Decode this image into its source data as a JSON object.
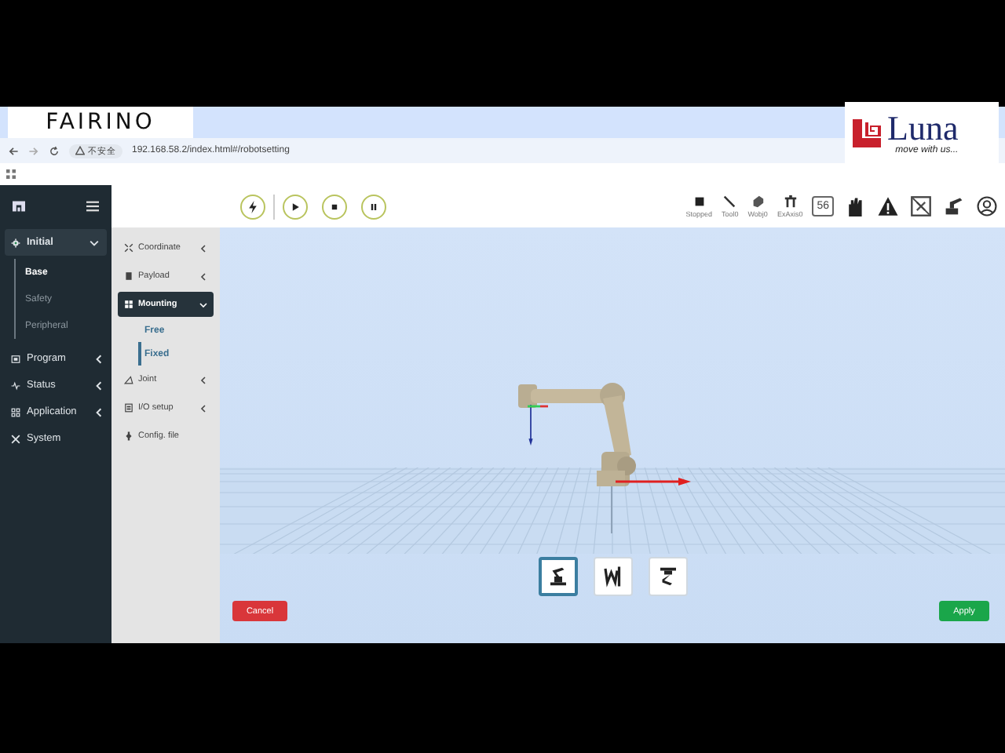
{
  "overlay_logos": {
    "left": "FAIRINO",
    "right_name": "Luna",
    "right_tagline": "move *with* us..."
  },
  "browser": {
    "security": "不安全",
    "url": "192.168.58.2/index.html#/robotsetting"
  },
  "toolbar": {
    "status_items": [
      {
        "kind": "state",
        "label": "Stopped"
      },
      {
        "kind": "tool",
        "label": "Tool0"
      },
      {
        "kind": "wobj",
        "label": "Wobj0"
      },
      {
        "kind": "exaxis",
        "label": "ExAxis0"
      }
    ],
    "speed": "56"
  },
  "sidebar": {
    "items": [
      {
        "label": "Initial",
        "selected": true,
        "expanded": true,
        "children": [
          {
            "label": "Base",
            "selected": true
          },
          {
            "label": "Safety",
            "selected": false
          },
          {
            "label": "Peripheral",
            "selected": false
          }
        ]
      },
      {
        "label": "Program",
        "selected": false,
        "expanded": false
      },
      {
        "label": "Status",
        "selected": false,
        "expanded": false
      },
      {
        "label": "Application",
        "selected": false,
        "expanded": false
      },
      {
        "label": "System",
        "selected": false
      }
    ]
  },
  "subnav": {
    "items": [
      {
        "label": "Coordinate",
        "selected": false,
        "expanded": false
      },
      {
        "label": "Payload",
        "selected": false,
        "expanded": false
      },
      {
        "label": "Mounting",
        "selected": true,
        "expanded": true,
        "children": [
          {
            "label": "Free",
            "selected": false
          },
          {
            "label": "Fixed",
            "selected": true
          }
        ]
      },
      {
        "label": "Joint",
        "selected": false,
        "expanded": false
      },
      {
        "label": "I/O setup",
        "selected": false,
        "expanded": false
      },
      {
        "label": "Config. file",
        "selected": false
      }
    ]
  },
  "mount_options": [
    {
      "kind": "floor",
      "selected": true
    },
    {
      "kind": "wall",
      "selected": false
    },
    {
      "kind": "ceiling",
      "selected": false
    }
  ],
  "buttons": {
    "cancel": "Cancel",
    "apply": "Apply"
  }
}
